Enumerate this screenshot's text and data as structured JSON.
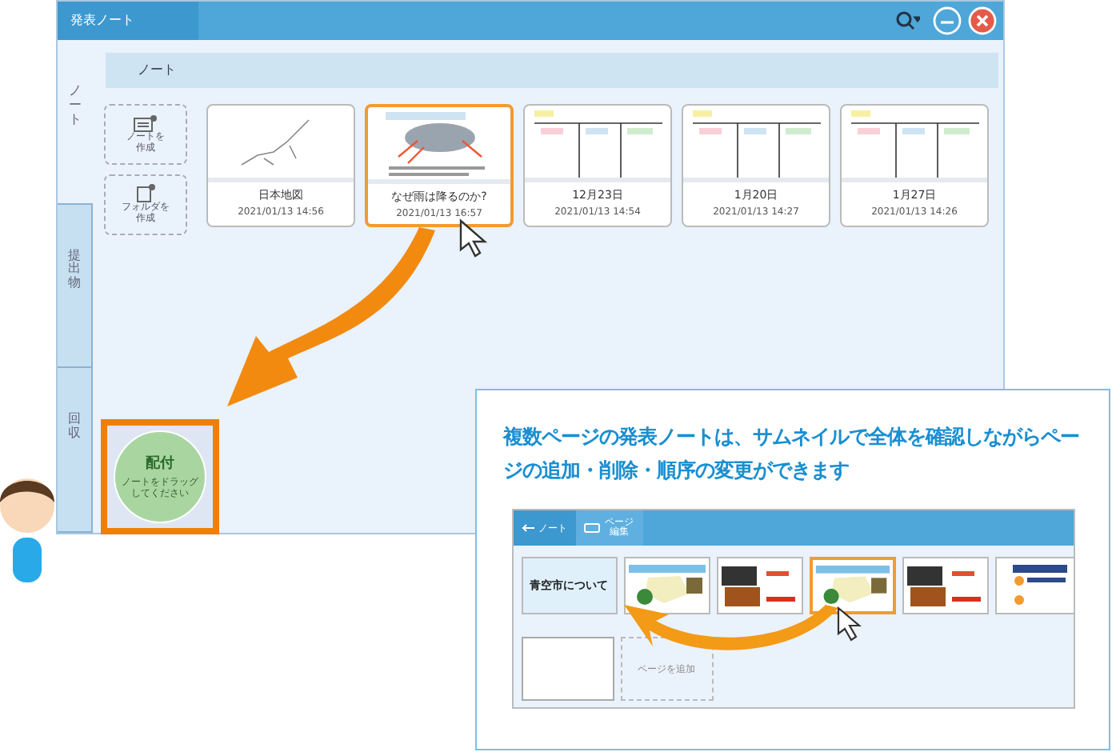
{
  "window": {
    "title": "発表ノート"
  },
  "side_tabs": [
    {
      "label": "ノート",
      "selected": true
    },
    {
      "label": "提出物",
      "selected": false
    },
    {
      "label": "回収",
      "selected": false
    }
  ],
  "header": {
    "label": "ノート"
  },
  "create_buttons": [
    {
      "label": "ノートを作成",
      "kind": "note"
    },
    {
      "label": "フォルダを作成",
      "kind": "folder"
    }
  ],
  "notes": [
    {
      "title": "日本地図",
      "date": "2021/01/13 14:56",
      "selected": false,
      "kind": "map"
    },
    {
      "title": "なぜ雨は降るのか?",
      "date": "2021/01/13 16:57",
      "selected": true,
      "kind": "diagram"
    },
    {
      "title": "12月23日",
      "date": "2021/01/13 14:54",
      "selected": false,
      "kind": "table"
    },
    {
      "title": "1月20日",
      "date": "2021/01/13 14:27",
      "selected": false,
      "kind": "table"
    },
    {
      "title": "1月27日",
      "date": "2021/01/13 14:26",
      "selected": false,
      "kind": "table"
    }
  ],
  "drop_zone": {
    "title": "配付",
    "hint": "ノートをドラッグしてください"
  },
  "callout": {
    "text": "複数ページの発表ノートは、サムネイルで全体を確認しながらページの追加・削除・順序の変更ができます",
    "toolbar": {
      "back": "ノート",
      "edit": "ページ編集"
    },
    "slides": [
      {
        "title": "青空市について",
        "kind": "title",
        "selected": false
      },
      {
        "kind": "map",
        "selected": false
      },
      {
        "kind": "photo",
        "selected": false
      },
      {
        "kind": "map",
        "selected": true
      },
      {
        "kind": "photo",
        "selected": false
      },
      {
        "kind": "list",
        "selected": false
      }
    ],
    "add_page": "ページを追加"
  }
}
